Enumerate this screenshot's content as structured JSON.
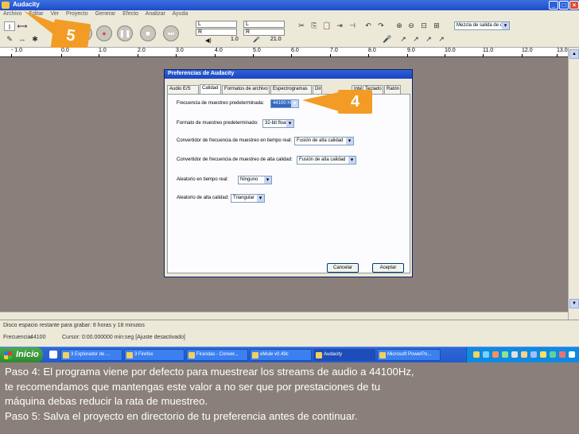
{
  "window": {
    "title": "Audacity"
  },
  "menubar": [
    "Archivo",
    "Editar",
    "Ver",
    "Proyecto",
    "Generar",
    "Efecto",
    "Analizar",
    "Ayuda"
  ],
  "transport": {
    "play_icon": "play-icon",
    "record_icon": "record-icon",
    "pause_icon": "pause-icon",
    "stop_icon": "stop-icon",
    "end_icon": "skip-end-icon"
  },
  "meters": {
    "left": "L",
    "right": "R",
    "play_val": "1.0",
    "rec_val": "1.0",
    "rec_num": "21.0"
  },
  "output_device": {
    "value": "Mezcla de salida de o"
  },
  "ruler": {
    "ticks": [
      "- 1.0",
      "0.0",
      "1.0",
      "2.0",
      "3.0",
      "4.0",
      "5.0",
      "6.0",
      "7.0",
      "8.0",
      "9.0",
      "10.0",
      "11.0",
      "12.0",
      "13.0"
    ]
  },
  "dialog": {
    "title": "Preferencias de Audacity",
    "tabs": [
      "Audio E/S",
      "Calidad",
      "Formatos de archivo",
      "Espectrogramas",
      "Directorios",
      "Interfaz",
      "Teclado",
      "Ratón"
    ],
    "rows": [
      {
        "label": "Frecuencia de muestreo predeterminada:",
        "value": "44100 Hz"
      },
      {
        "label": "Formato de muestreo predeterminado:",
        "value": "32-bit float"
      },
      {
        "label": "Convertidor de frecuencia de muestreo en tiempo real:",
        "value": "Fusión de alta calidad"
      },
      {
        "label": "Convertidor de frecuencia de muestreo de alta calidad:",
        "value": "Fusión de alta calidad"
      },
      {
        "label": "Aleatorio en tiempo real:",
        "value": "Ninguno"
      },
      {
        "label": "Aleatorio de alta calidad:",
        "value": "Triangular"
      }
    ],
    "cancel": "Cancelar",
    "accept": "Aceptar"
  },
  "badges": {
    "step4": "4",
    "step5": "5"
  },
  "status": {
    "line1": "Disco espacio restante para grabar: 8 horas y 18 minutos",
    "rate_label": "Frecuencia:",
    "rate_value": "44100",
    "cursor": "Cursor: 0:00.000000 min:seg  [Ajuste desactivado]"
  },
  "taskbar": {
    "start": "Inicio",
    "tasks": [
      "3 Explorador de ...",
      "3 Firefox",
      "Firandas - Conver...",
      "eMule v0.49c",
      "Audacity",
      "Microsoft PowerPo..."
    ]
  },
  "caption": {
    "line1": "Paso 4: El programa viene por defecto para muestrear los streams de audio a 44100Hz,",
    "line2": "te recomendamos que mantengas este valor a no ser que por prestaciones de tu",
    "line3": "máquina debas reducir la rata de muestreo.",
    "line4": "Paso 5: Salva el proyecto en directorio de tu preferencia antes de continuar."
  },
  "colors": {
    "badge": "#f29c26",
    "titlebar": "#245ad0",
    "caption_bg": "#8a7f7a"
  }
}
